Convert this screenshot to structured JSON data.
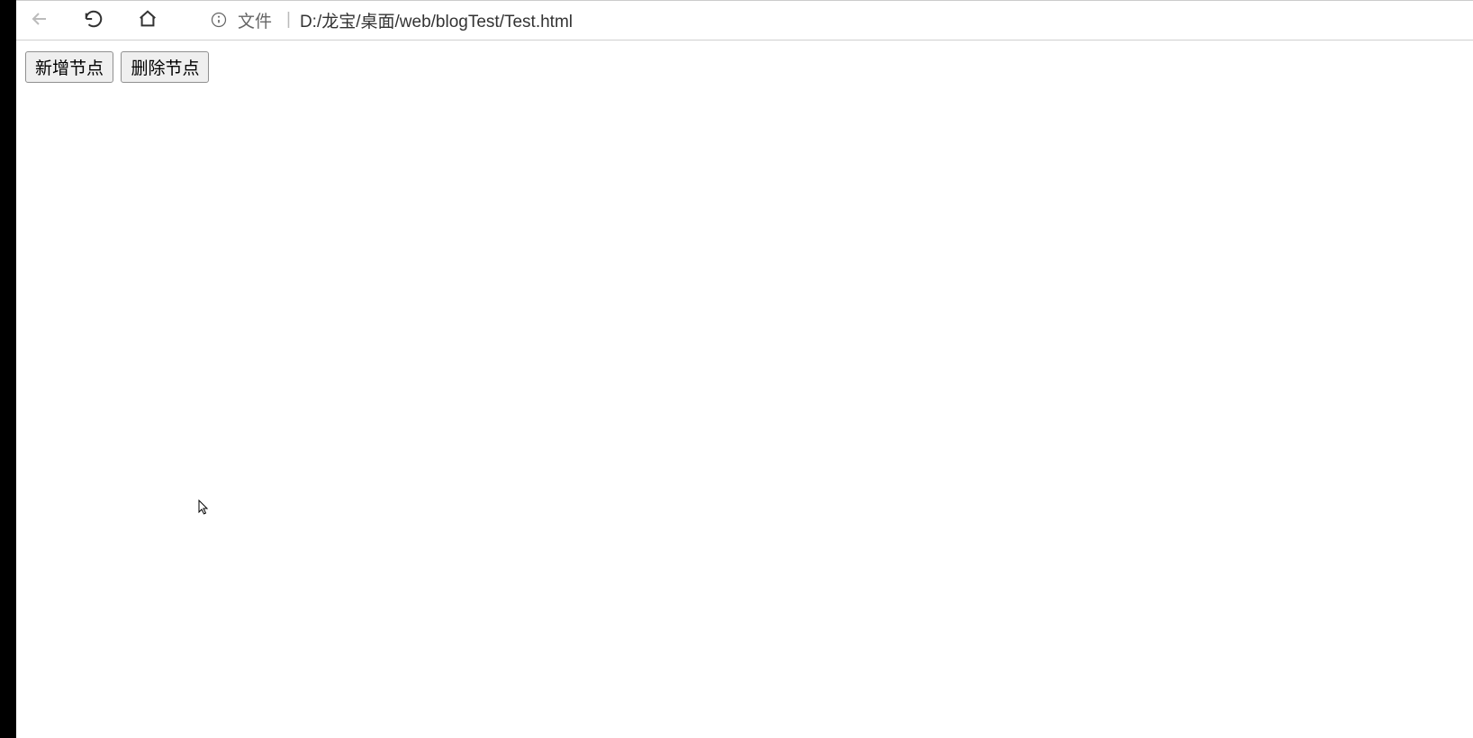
{
  "browser": {
    "address_bar": {
      "file_label": "文件",
      "separator": "|",
      "url": "D:/龙宝/桌面/web/blogTest/Test.html"
    }
  },
  "page": {
    "buttons": {
      "add_node": "新增节点",
      "delete_node": "删除节点"
    }
  }
}
